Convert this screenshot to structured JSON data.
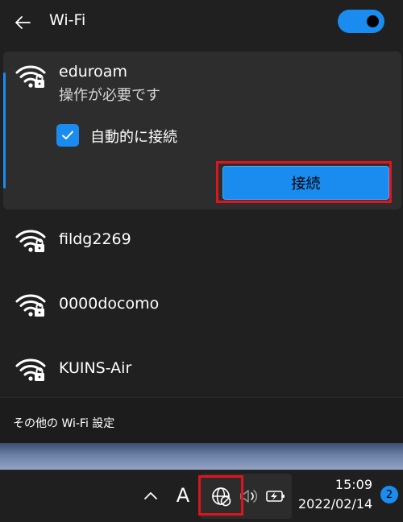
{
  "header": {
    "title": "Wi-Fi",
    "back_icon": "arrow-left-icon",
    "toggle_state": "on"
  },
  "networks": {
    "expanded": {
      "name": "eduroam",
      "status": "操作が必要です",
      "auto_connect_label": "自動的に接続",
      "auto_connect_checked": true,
      "connect_label": "接続",
      "icon": "wifi-secured-icon"
    },
    "others": [
      {
        "name": "fildg2269",
        "icon": "wifi-secured-icon"
      },
      {
        "name": "0000docomo",
        "icon": "wifi-secured-icon"
      },
      {
        "name": "KUINS-Air",
        "icon": "wifi-secured-icon"
      }
    ]
  },
  "footer": {
    "settings_link": "その他の Wi-Fi 設定"
  },
  "taskbar": {
    "chevron_icon": "chevron-up-icon",
    "ime_label": "A",
    "network_icon": "globe-no-internet-icon",
    "volume_icon": "speaker-icon",
    "battery_icon": "battery-charging-icon",
    "time": "15:09",
    "date": "2022/02/14",
    "notification_count": "2"
  },
  "colors": {
    "accent": "#1a8cf0",
    "highlight": "#e0141e",
    "panel": "#202020",
    "card": "#2d2d2d"
  }
}
